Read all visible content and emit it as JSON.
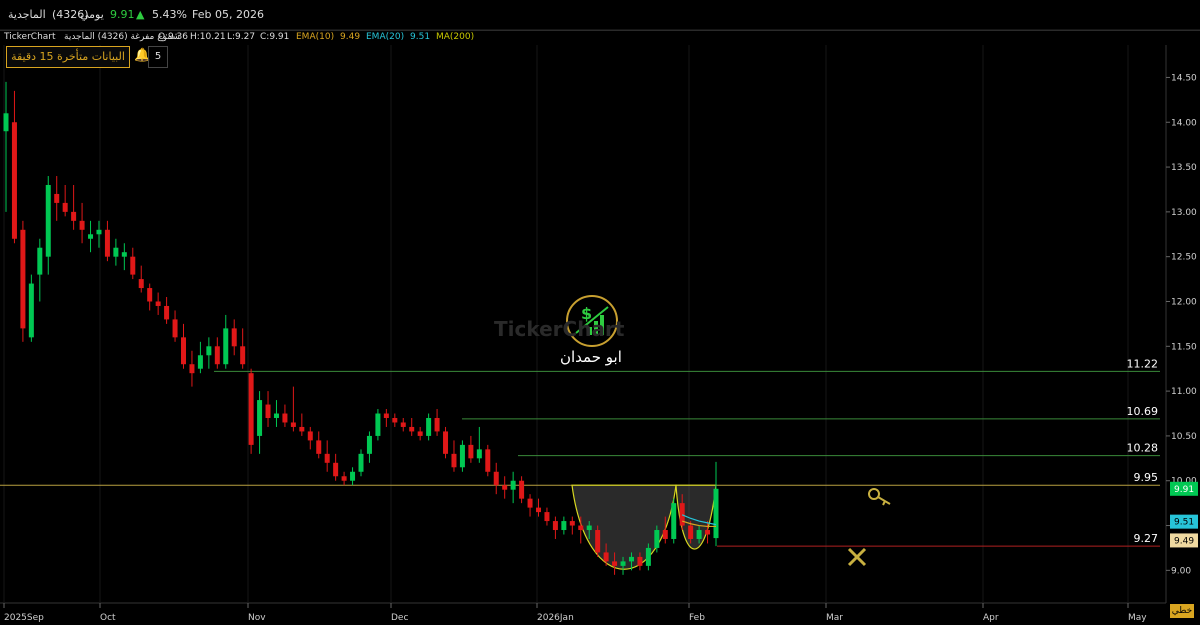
{
  "topbar": {
    "symbol": "الماجدية",
    "code": "(4326)",
    "period": "يومي",
    "price": "9.91",
    "change_pct": "5.43%",
    "date": "Feb 05, 2026"
  },
  "infobar": {
    "source": "TickerChart",
    "chart_desc": "شموع مفرغة (4326) الماجدية",
    "open": "O:9.36",
    "high": "H:10.21",
    "low": "L:9.27",
    "close": "C:9.91",
    "ema10_label": "EMA(10)",
    "ema10_value": "9.49",
    "ema20_label": "EMA(20)",
    "ema20_value": "9.51",
    "ma200_label": "MA(200)"
  },
  "delay_banner": "البيانات متأخرة 15 دقيقة",
  "alert_count": "5",
  "watermark": {
    "brand": "TickerChart",
    "name": "ابو حمدان"
  },
  "line_mode_button": "خطي",
  "colors": {
    "up": "#00c853",
    "down": "#e01818",
    "ema10": "#d9a520",
    "ema20": "#27c4d8",
    "ma200": "#c8c800",
    "level_line": "#3a8a3a",
    "price_line": "#b8a040",
    "stop_line": "#b02020"
  },
  "chart_data": {
    "type": "candlestick",
    "x_labels": [
      "2025Sep",
      "Oct",
      "Nov",
      "Dec",
      "2026Jan",
      "Feb",
      "Mar",
      "Apr",
      "May"
    ],
    "y_ticks": [
      "14.50",
      "14.00",
      "13.50",
      "13.00",
      "12.50",
      "12.00",
      "11.50",
      "11.00",
      "10.50",
      "10.00",
      "9.50",
      "9.00"
    ],
    "ylim": [
      8.87,
      14.65
    ],
    "levels": [
      {
        "value": 11.22,
        "label": "11.22"
      },
      {
        "value": 10.69,
        "label": "10.69"
      },
      {
        "value": 10.28,
        "label": "10.28"
      },
      {
        "value": 9.95,
        "label": "9.95"
      },
      {
        "value": 9.27,
        "label": "9.27"
      }
    ],
    "price_tags": [
      {
        "value": 9.91,
        "label": "9.91"
      },
      {
        "value": 9.51,
        "label": "9.51"
      },
      {
        "value": 9.49,
        "label": "9.49"
      }
    ],
    "candles": [
      [
        13.9,
        14.45,
        13.0,
        14.1
      ],
      [
        14.0,
        14.35,
        12.65,
        12.7
      ],
      [
        12.8,
        12.9,
        11.55,
        11.7
      ],
      [
        11.6,
        12.3,
        11.55,
        12.2
      ],
      [
        12.3,
        12.7,
        12.0,
        12.6
      ],
      [
        12.5,
        13.4,
        12.3,
        13.3
      ],
      [
        13.2,
        13.4,
        12.9,
        13.1
      ],
      [
        13.1,
        13.3,
        12.95,
        13.0
      ],
      [
        13.0,
        13.3,
        12.8,
        12.9
      ],
      [
        12.9,
        13.1,
        12.65,
        12.8
      ],
      [
        12.7,
        12.9,
        12.55,
        12.75
      ],
      [
        12.75,
        12.9,
        12.6,
        12.8
      ],
      [
        12.8,
        12.9,
        12.45,
        12.5
      ],
      [
        12.5,
        12.7,
        12.4,
        12.6
      ],
      [
        12.5,
        12.65,
        12.35,
        12.55
      ],
      [
        12.5,
        12.6,
        12.25,
        12.3
      ],
      [
        12.25,
        12.4,
        12.1,
        12.15
      ],
      [
        12.15,
        12.2,
        11.9,
        12.0
      ],
      [
        12.0,
        12.1,
        11.85,
        11.95
      ],
      [
        11.95,
        12.05,
        11.75,
        11.8
      ],
      [
        11.8,
        11.9,
        11.55,
        11.6
      ],
      [
        11.6,
        11.75,
        11.25,
        11.3
      ],
      [
        11.3,
        11.45,
        11.05,
        11.2
      ],
      [
        11.25,
        11.55,
        11.2,
        11.4
      ],
      [
        11.4,
        11.6,
        11.25,
        11.5
      ],
      [
        11.5,
        11.6,
        11.25,
        11.3
      ],
      [
        11.3,
        11.85,
        11.25,
        11.7
      ],
      [
        11.7,
        11.8,
        11.4,
        11.5
      ],
      [
        11.5,
        11.7,
        11.25,
        11.3
      ],
      [
        11.2,
        11.25,
        10.3,
        10.4
      ],
      [
        10.5,
        11.0,
        10.3,
        10.9
      ],
      [
        10.85,
        11.0,
        10.6,
        10.7
      ],
      [
        10.7,
        10.9,
        10.6,
        10.75
      ],
      [
        10.75,
        10.85,
        10.6,
        10.65
      ],
      [
        10.65,
        11.05,
        10.55,
        10.6
      ],
      [
        10.6,
        10.75,
        10.5,
        10.55
      ],
      [
        10.55,
        10.6,
        10.35,
        10.45
      ],
      [
        10.45,
        10.55,
        10.25,
        10.3
      ],
      [
        10.3,
        10.45,
        10.1,
        10.2
      ],
      [
        10.2,
        10.3,
        10.0,
        10.05
      ],
      [
        10.05,
        10.1,
        9.95,
        10.0
      ],
      [
        10.0,
        10.15,
        9.95,
        10.1
      ],
      [
        10.1,
        10.35,
        10.05,
        10.3
      ],
      [
        10.3,
        10.55,
        10.2,
        10.5
      ],
      [
        10.5,
        10.8,
        10.45,
        10.75
      ],
      [
        10.75,
        10.8,
        10.6,
        10.7
      ],
      [
        10.7,
        10.75,
        10.6,
        10.65
      ],
      [
        10.65,
        10.7,
        10.55,
        10.6
      ],
      [
        10.6,
        10.7,
        10.5,
        10.55
      ],
      [
        10.55,
        10.6,
        10.45,
        10.5
      ],
      [
        10.5,
        10.75,
        10.45,
        10.7
      ],
      [
        10.7,
        10.8,
        10.5,
        10.55
      ],
      [
        10.55,
        10.6,
        10.25,
        10.3
      ],
      [
        10.3,
        10.45,
        10.1,
        10.15
      ],
      [
        10.15,
        10.45,
        10.1,
        10.4
      ],
      [
        10.4,
        10.5,
        10.2,
        10.25
      ],
      [
        10.25,
        10.6,
        10.2,
        10.35
      ],
      [
        10.35,
        10.4,
        10.05,
        10.1
      ],
      [
        10.1,
        10.2,
        9.85,
        9.95
      ],
      [
        9.95,
        10.05,
        9.8,
        9.9
      ],
      [
        9.9,
        10.1,
        9.75,
        10.0
      ],
      [
        10.0,
        10.05,
        9.75,
        9.8
      ],
      [
        9.8,
        9.85,
        9.6,
        9.7
      ],
      [
        9.7,
        9.8,
        9.6,
        9.65
      ],
      [
        9.65,
        9.7,
        9.5,
        9.55
      ],
      [
        9.55,
        9.6,
        9.35,
        9.45
      ],
      [
        9.45,
        9.6,
        9.4,
        9.55
      ],
      [
        9.55,
        9.6,
        9.4,
        9.5
      ],
      [
        9.5,
        9.6,
        9.3,
        9.45
      ],
      [
        9.45,
        9.55,
        9.35,
        9.5
      ],
      [
        9.45,
        9.5,
        9.15,
        9.2
      ],
      [
        9.2,
        9.3,
        9.05,
        9.1
      ],
      [
        9.1,
        9.2,
        8.95,
        9.05
      ],
      [
        9.05,
        9.15,
        8.95,
        9.1
      ],
      [
        9.1,
        9.2,
        9.0,
        9.15
      ],
      [
        9.15,
        9.2,
        9.0,
        9.05
      ],
      [
        9.05,
        9.3,
        9.0,
        9.25
      ],
      [
        9.25,
        9.5,
        9.2,
        9.45
      ],
      [
        9.45,
        9.6,
        9.3,
        9.35
      ],
      [
        9.35,
        9.8,
        9.3,
        9.75
      ],
      [
        9.75,
        9.85,
        9.45,
        9.5
      ],
      [
        9.5,
        9.55,
        9.3,
        9.35
      ],
      [
        9.35,
        9.5,
        9.3,
        9.45
      ],
      [
        9.45,
        9.55,
        9.3,
        9.4
      ],
      [
        9.36,
        10.21,
        9.27,
        9.91
      ]
    ],
    "ema10": [
      9.55,
      9.52,
      9.5,
      9.49,
      9.49
    ],
    "ema20": [
      9.62,
      9.58,
      9.55,
      9.53,
      9.51
    ]
  }
}
